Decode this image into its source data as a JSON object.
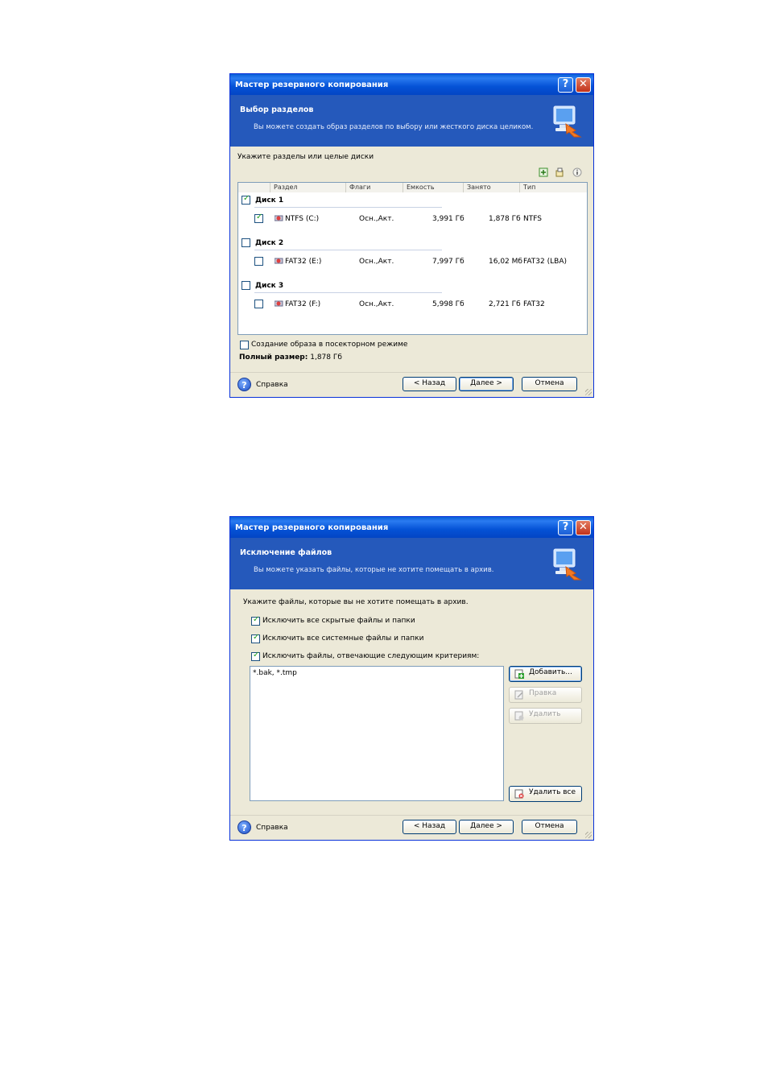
{
  "window1": {
    "title": "Мастер резервного копирования",
    "header_title": "Выбор разделов",
    "header_subtitle": "Вы можете создать образ разделов по выбору или жесткого диска целиком.",
    "instruction": "Укажите разделы или целые диски",
    "columns": [
      "Раздел",
      "Флаги",
      "Емкость",
      "Занято",
      "Тип"
    ],
    "disks": [
      {
        "label": "Диск 1",
        "checked": true,
        "partition": {
          "name": "NTFS (C:)",
          "flags": "Осн.,Акт.",
          "capacity": "3,991 Гб",
          "used": "1,878 Гб",
          "type": "NTFS",
          "checked": true
        }
      },
      {
        "label": "Диск 2",
        "checked": false,
        "partition": {
          "name": "FAT32 (E:)",
          "flags": "Осн.,Акт.",
          "capacity": "7,997 Гб",
          "used": "16,02 Мб",
          "type": "FAT32 (LBA)",
          "checked": false
        }
      },
      {
        "label": "Диск 3",
        "checked": false,
        "partition": {
          "name": "FAT32 (F:)",
          "flags": "Осн.,Акт.",
          "capacity": "5,998 Гб",
          "used": "2,721 Гб",
          "type": "FAT32",
          "checked": false
        }
      }
    ],
    "sector_mode_label": "Создание образа в посекторном режиме",
    "total_size_label": "Полный размер:",
    "total_size_value": "1,878 Гб",
    "help_label": "Справка",
    "back_label": "< Назад",
    "next_label": "Далее >",
    "cancel_label": "Отмена"
  },
  "window2": {
    "title": "Мастер резервного копирования",
    "header_title": "Исключение файлов",
    "header_subtitle": "Вы можете указать файлы, которые не хотите помещать в архив.",
    "instruction": "Укажите файлы, которые вы не хотите помещать в архив.",
    "options": [
      {
        "label": "Исключить все скрытые файлы и папки",
        "checked": true
      },
      {
        "label": "Исключить все системные файлы и папки",
        "checked": true
      },
      {
        "label": "Исключить файлы, отвечающие следующим критериям:",
        "checked": true
      }
    ],
    "criteria_text": "*.bak, *.tmp",
    "add_label": "Добавить...",
    "edit_label": "Правка",
    "delete_label": "Удалить",
    "delete_all_label": "Удалить все",
    "help_label": "Справка",
    "back_label": "< Назад",
    "next_label": "Далее >",
    "cancel_label": "Отмена"
  },
  "colors": {
    "title_bar": "#0a5fd8",
    "header_bg": "#2559bb",
    "dialog_bg": "#ece9d8",
    "checkmark": "#21a121"
  }
}
